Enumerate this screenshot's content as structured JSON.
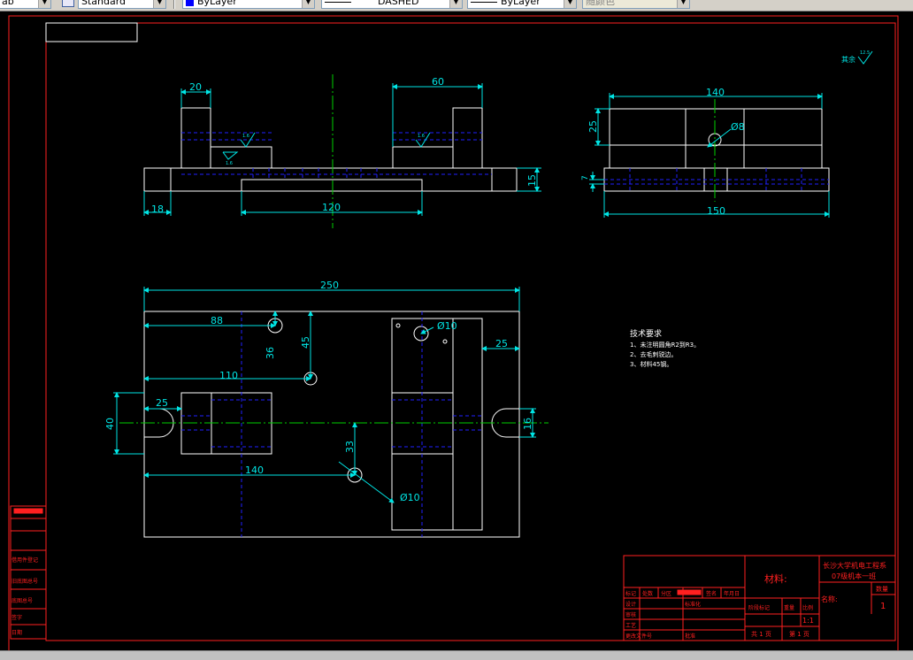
{
  "toolbar": {
    "combo_left": "ab",
    "text_style": "Standard",
    "layer_color": "ByLayer",
    "linetype": "DASHED",
    "lineweight": "ByLayer",
    "plot_style": "随颜色"
  },
  "colors": {
    "background": "#000000",
    "frame": "#ff2020",
    "geometry": "#ffffff",
    "dimension": "#00e5e5",
    "center": "#00d000",
    "hidden": "#2020ff",
    "roughness": "#00e5e5"
  },
  "drawing": {
    "front_view": {
      "dim_20": "20",
      "dim_60": "60",
      "dim_18": "18",
      "dim_120": "120",
      "dim_15": "15",
      "rough_a": "1.6",
      "rough_b": "1.6",
      "rough_c": "1.6"
    },
    "side_view": {
      "dim_140": "140",
      "dim_25": "25",
      "dim_phi8": "Ø8",
      "dim_7": "7",
      "dim_150": "150"
    },
    "top_view": {
      "dim_250": "250",
      "dim_88": "88",
      "dim_36": "36",
      "dim_45": "45",
      "dim_110": "110",
      "dim_25_left": "25",
      "dim_40": "40",
      "dim_140": "140",
      "dim_33": "33",
      "dim_phi10_a": "Ø10",
      "dim_phi10_b": "Ø10",
      "dim_25_right": "25",
      "dim_16": "16"
    },
    "rough_corner": {
      "label": "其余",
      "value": "12.5"
    }
  },
  "tech_requirements": {
    "title": "技术要求",
    "items": [
      "1、未注明圆角R2到R3。",
      "2、去毛刺锐边。",
      "3、材料45钢。"
    ]
  },
  "title_block": {
    "material": "材料:",
    "school": "长沙大学机电工程系",
    "class": "07级机本一班",
    "name_label": "名称:",
    "count_label": "数量",
    "count_value": "1",
    "scale": "1:1",
    "total_sheets": "共 1 页",
    "sheet_no": "第 1 页",
    "stage_label": "阶段标记",
    "weight_label": "重量",
    "ratio_label": "比例",
    "headers": [
      "标记",
      "处数",
      "分区",
      "更改文件号",
      "签名",
      "年月日"
    ],
    "rows": [
      "设计",
      "审核",
      "工艺",
      "标准化",
      "批准"
    ],
    "left_labels": [
      "借用件登记",
      "旧底图总号",
      "底图总号",
      "签字",
      "日期"
    ]
  }
}
